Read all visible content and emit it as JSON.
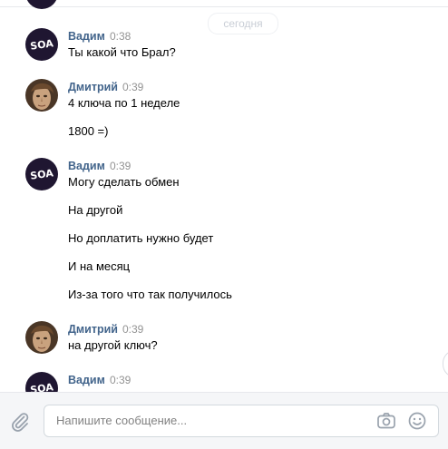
{
  "date_separator": "сегодня",
  "messages": [
    {
      "author": "Вадим",
      "time": "0:38",
      "avatar": "soa-logo-avatar",
      "avatar_text": "SOA",
      "lines": [
        "Ты какой что Брал?"
      ]
    },
    {
      "author": "Дмитрий",
      "time": "0:39",
      "avatar": "portrait-avatar",
      "lines": [
        "4 ключа по 1 неделе",
        "1800 =)"
      ]
    },
    {
      "author": "Вадим",
      "time": "0:39",
      "avatar": "soa-logo-avatar",
      "avatar_text": "SOA",
      "lines": [
        "Могу сделать обмен",
        "На другой",
        "Но доплатить нужно будет",
        "И на месяц",
        "Из-за того что так получилось"
      ]
    },
    {
      "author": "Дмитрий",
      "time": "0:39",
      "avatar": "portrait-avatar",
      "lines": [
        "на другой ключ?"
      ]
    },
    {
      "author": "Вадим",
      "time": "0:39",
      "avatar": "soa-logo-avatar",
      "avatar_text": "SOA",
      "lines": []
    }
  ],
  "composer": {
    "placeholder": "Напишите сообщение...",
    "attach_icon": "paperclip-icon",
    "camera_icon": "camera-icon",
    "emoji_icon": "smile-icon"
  },
  "colors": {
    "author_name": "#42648b",
    "timestamp": "#939393",
    "composer_bg": "#f5f6f8",
    "soa_avatar_bg": "#1f1631"
  }
}
